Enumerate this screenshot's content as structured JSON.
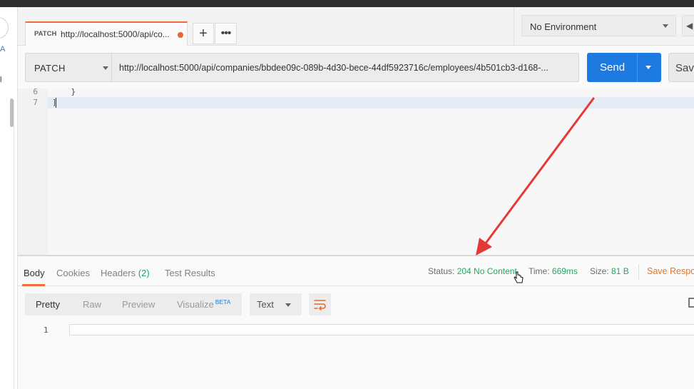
{
  "tab": {
    "method": "PATCH",
    "url": "http://localhost:5000/api/co..."
  },
  "environment": {
    "selected": "No Environment"
  },
  "request": {
    "method": "PATCH",
    "url": "http://localhost:5000/api/companies/bbdee09c-089b-4d30-bece-44df5923716c/employees/4b501cb3-d168-...",
    "send_label": "Send",
    "save_label": "Save"
  },
  "editor": {
    "lines": [
      {
        "num": "6",
        "text": "    }"
      },
      {
        "num": "7",
        "text": "]"
      }
    ]
  },
  "response": {
    "tabs": {
      "body": "Body",
      "cookies": "Cookies",
      "headers": "Headers",
      "headers_count": "(2)",
      "tests": "Test Results"
    },
    "status_label": "Status:",
    "status_value": "204 No Content",
    "time_label": "Time:",
    "time_value": "669ms",
    "size_label": "Size:",
    "size_value": "81 B",
    "save_response": "Save Respo",
    "views": {
      "pretty": "Pretty",
      "raw": "Raw",
      "preview": "Preview",
      "visualize": "Visualize",
      "beta": "BETA"
    },
    "format": "Text",
    "line_number": "1"
  },
  "colors": {
    "accent": "#f26b3a",
    "send": "#1d7ae0",
    "status_ok": "#27a465",
    "annotation_arrow": "#e53935"
  }
}
